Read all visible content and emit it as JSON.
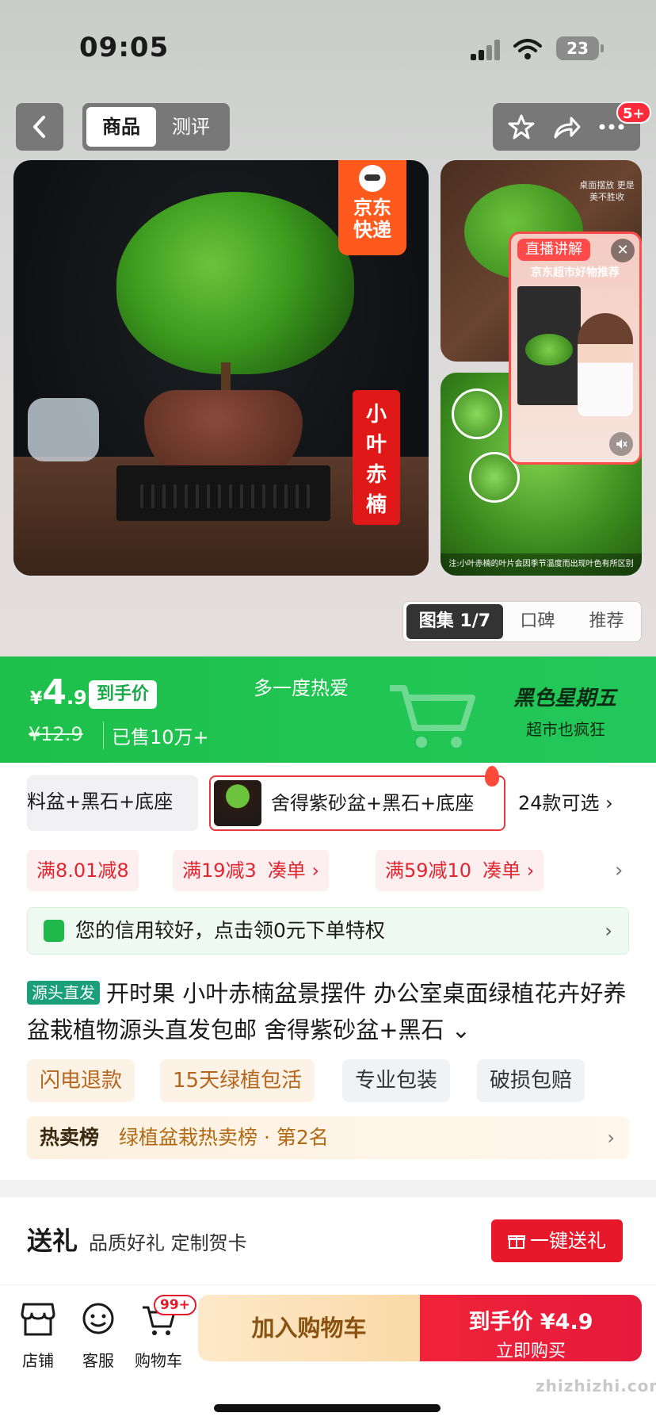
{
  "status_bar": {
    "time": "09:05",
    "battery": "23"
  },
  "header": {
    "tabs": [
      {
        "label": "商品",
        "active": true
      },
      {
        "label": "测评",
        "active": false
      }
    ],
    "more_badge": "5+"
  },
  "gallery": {
    "ship_tag": "京东快递",
    "product_name_seal": "小叶赤楠",
    "side_text": "桌面摆放 更是美不胜收",
    "side_note": "注:小叶赤楠的叶片会因季节温度而出现叶色有所区别",
    "live": {
      "tag": "直播讲解",
      "subtitle": "京东超市好物推荐"
    },
    "tabs": [
      {
        "label": "图集 1/7",
        "active": true
      },
      {
        "label": "口碑",
        "active": false
      },
      {
        "label": "推荐",
        "active": false
      }
    ]
  },
  "promo": {
    "currency": "¥",
    "price_int": "4",
    "price_dec": ".9",
    "price_tag": "到手价",
    "original_price": "¥12.9",
    "sold": "已售10万+",
    "slogan": "多一度热爱",
    "event_title": "黑色星期五",
    "event_sub": "超市也疯狂",
    "accent": "#22c55a"
  },
  "variants": {
    "items": [
      "料盆+黑石+底座",
      "舍得紫砂盆+黑石+底座"
    ],
    "more": "24款可选 ›"
  },
  "coupons": [
    {
      "text": "满8.01减8",
      "link": ""
    },
    {
      "text": "满19减3",
      "link": "凑单 ›"
    },
    {
      "text": "满59减10",
      "link": "凑单 ›"
    }
  ],
  "credit": {
    "text": "您的信用较好，点击领0元下单特权",
    "arrow": "›"
  },
  "title": {
    "source_tag": "源头直发",
    "text": "开时果 小叶赤楠盆景摆件 办公室桌面绿植花卉好养盆栽植物源头直发包邮 舍得紫砂盆+黑石 ⌄"
  },
  "services": [
    "闪电退款",
    "15天绿植包活",
    "专业包装",
    "破损包赔"
  ],
  "rank": {
    "label": "热卖榜",
    "value": "绿植盆栽热卖榜 · 第2名",
    "arrow": "›"
  },
  "gift": {
    "label": "送礼",
    "sub": "品质好礼 定制贺卡",
    "button": "一键送礼"
  },
  "bottom_bar": {
    "items": [
      {
        "label": "店铺",
        "icon": "store-icon"
      },
      {
        "label": "客服",
        "icon": "service-icon"
      },
      {
        "label": "购物车",
        "icon": "cart-icon"
      }
    ],
    "cart_badge": "99+",
    "add_cart": "加入购物车",
    "buy_line1": "到手价 ¥4.9",
    "buy_line2": "立即购买"
  },
  "watermark": "zhizhizhi.com"
}
